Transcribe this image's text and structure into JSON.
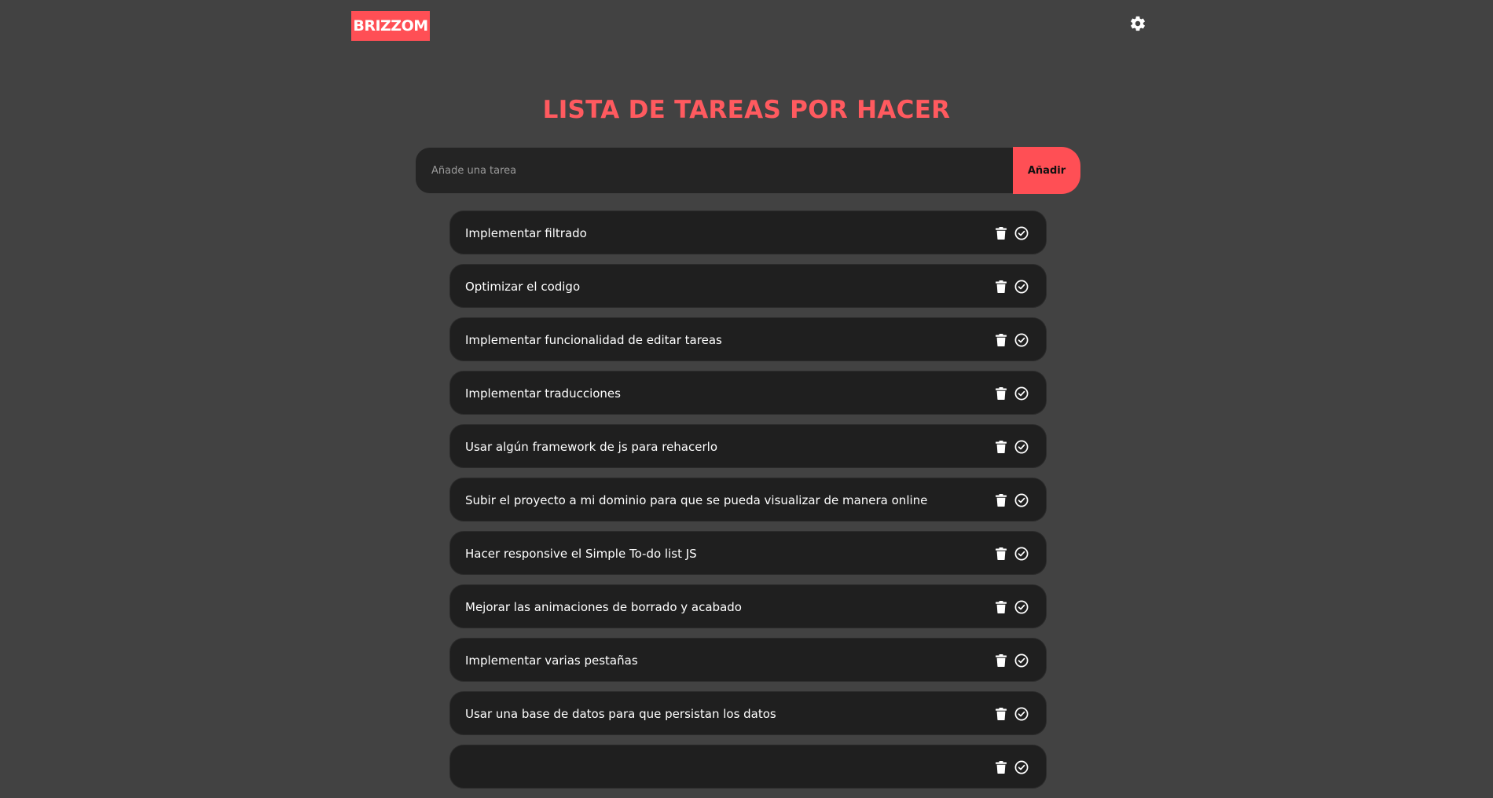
{
  "header": {
    "logo": "BRIZZOM",
    "settings_icon": "gear-icon"
  },
  "main": {
    "title": "LISTA DE TAREAS POR HACER",
    "input_placeholder": "Añade una tarea",
    "add_label": "Añadir",
    "tasks": [
      {
        "text": "Implementar filtrado"
      },
      {
        "text": "Optimizar el codigo"
      },
      {
        "text": "Implementar funcionalidad de editar tareas"
      },
      {
        "text": "Implementar traducciones"
      },
      {
        "text": "Usar algún framework de js para rehacerlo"
      },
      {
        "text": "Subir el proyecto a mi dominio para que se pueda visualizar de manera online"
      },
      {
        "text": "Hacer responsive el Simple To-do list JS"
      },
      {
        "text": "Mejorar las animaciones de borrado y acabado"
      },
      {
        "text": "Implementar varias pestañas"
      },
      {
        "text": "Usar una base de datos para que persistan los datos"
      },
      {
        "text": ""
      }
    ],
    "task_icons": [
      "trash-icon",
      "check-circle-icon"
    ]
  },
  "colors": {
    "background": "#424242",
    "accent": "#ff4f55",
    "card": "#1f1f1f",
    "input": "#242424"
  }
}
